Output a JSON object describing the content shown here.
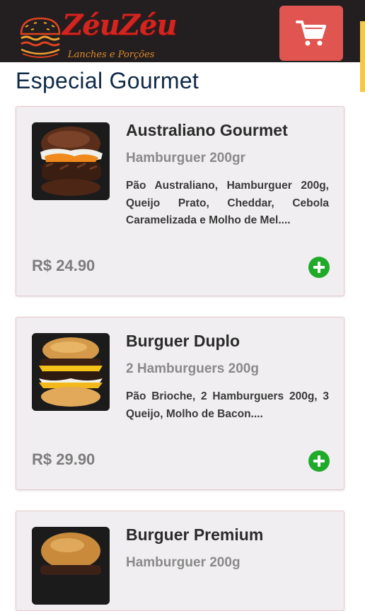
{
  "header": {
    "logo_title": "ZéuZéu",
    "logo_subtitle": "Lanches e Porções",
    "cart_icon": "shopping-cart-icon"
  },
  "section": {
    "title": "Especial Gourmet"
  },
  "products": [
    {
      "name": "Australiano Gourmet",
      "subtitle": "Hamburguer 200gr",
      "description": "Pão Australiano, Hamburguer 200g, Queijo Prato, Cheddar, Cebola Caramelizada e Molho de Mel....",
      "price": "R$ 24.90"
    },
    {
      "name": "Burguer Duplo",
      "subtitle": "2 Hamburguers 200g",
      "description": "Pão Brioche, 2 Hamburguers 200g, 3 Queijo, Molho de Bacon....",
      "price": "R$ 29.90"
    },
    {
      "name": "Burguer Premium",
      "subtitle": "Hamburguer 200g"
    }
  ],
  "colors": {
    "header_bg": "#231f20",
    "cart_button": "#e05550",
    "title": "#0f2a47",
    "add_button": "#1faa2a"
  }
}
